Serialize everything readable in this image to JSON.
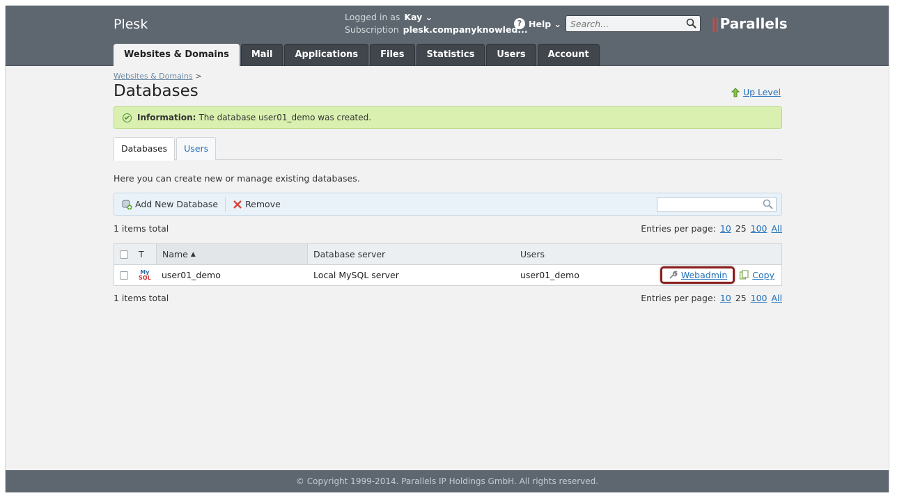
{
  "header": {
    "brand": "Plesk",
    "logged_in_label": "Logged in as",
    "user": "Kay",
    "subscription_label": "Subscription",
    "subscription": "plesk.companyknowled...",
    "help_label": "Help",
    "search_placeholder": "Search...",
    "parallels_logo": "Parallels"
  },
  "nav": {
    "tabs": [
      {
        "label": "Websites & Domains",
        "active": true
      },
      {
        "label": "Mail"
      },
      {
        "label": "Applications"
      },
      {
        "label": "Files"
      },
      {
        "label": "Statistics"
      },
      {
        "label": "Users"
      },
      {
        "label": "Account"
      }
    ]
  },
  "breadcrumb": {
    "link": "Websites & Domains",
    "sep": ">"
  },
  "page": {
    "title": "Databases",
    "up_level": "Up Level",
    "info_label": "Information:",
    "info_text": "The database user01_demo was created.",
    "subtabs": [
      {
        "label": "Databases",
        "active": true
      },
      {
        "label": "Users"
      }
    ],
    "hint": "Here you can create new or manage existing databases."
  },
  "toolbar": {
    "add_label": "Add New Database",
    "remove_label": "Remove"
  },
  "pager": {
    "items_total": "1 items total",
    "entries_label": "Entries per page:",
    "opt_10": "10",
    "opt_25": "25",
    "opt_100": "100",
    "opt_all": "All"
  },
  "table": {
    "columns": {
      "type": "T",
      "name": "Name",
      "sort_indicator": "▲",
      "server": "Database server",
      "users": "Users"
    },
    "rows": [
      {
        "type_icon": "mysql-icon",
        "type_my": "My",
        "type_sql": "SQL",
        "name": "user01_demo",
        "server": "Local MySQL server",
        "users": "user01_demo",
        "action_webadmin": "Webadmin",
        "action_copy": "Copy"
      }
    ]
  },
  "footer": {
    "copyright": "© Copyright 1999-2014. Parallels IP Holdings GmbH. All rights reserved."
  },
  "colors": {
    "topbar": "#5e6770",
    "accent_link": "#2270b8",
    "info_bg": "#d9f0b0",
    "highlight": "#8a1c1c"
  }
}
